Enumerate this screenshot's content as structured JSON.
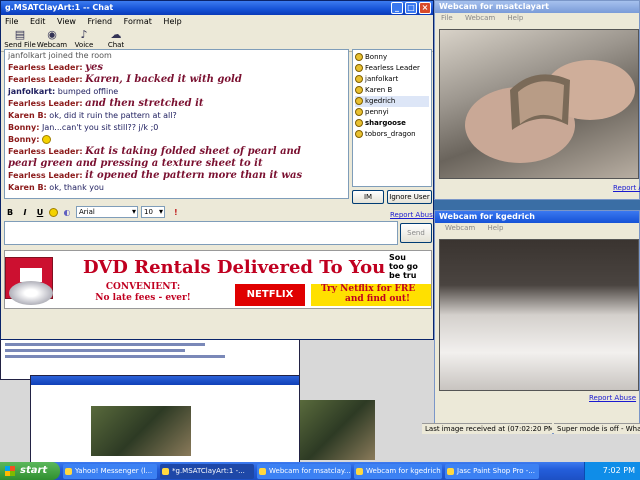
{
  "chat_window": {
    "title": "g.MSATClayArt:1 -- Chat",
    "menu": [
      "File",
      "Edit",
      "View",
      "Friend",
      "Format",
      "Help"
    ],
    "toolbar": [
      {
        "label": "Send File",
        "icon": "send-file-icon"
      },
      {
        "label": "Webcam",
        "icon": "webcam-icon"
      },
      {
        "label": "Voice",
        "icon": "voice-icon"
      },
      {
        "label": "Chat",
        "icon": "chat-icon"
      }
    ],
    "transcript": [
      {
        "who": "",
        "text": "janfolkart joined the room",
        "style": "sys"
      },
      {
        "who": "Fearless Leader:",
        "text": "yes",
        "style": "ital"
      },
      {
        "who": "Fearless Leader:",
        "text": "Karen, I backed it with gold",
        "style": "ital"
      },
      {
        "who": "janfolkart:",
        "text": "bumped offline",
        "style": "plain"
      },
      {
        "who": "Fearless Leader:",
        "text": "and then stretched it",
        "style": "ital"
      },
      {
        "who": "Karen B:",
        "text": "ok, did it ruin the pattern at all?",
        "style": "plain"
      },
      {
        "who": "Bonny:",
        "text": "Jan...can't you sit still?? j/k ;0",
        "style": "plain"
      },
      {
        "who": "Bonny:",
        "text": "",
        "style": "smiley"
      },
      {
        "who": "Fearless Leader:",
        "text": "Kat is taking folded sheet of pearl and",
        "style": "ital"
      },
      {
        "who": "",
        "text": "pearl green and pressing a texture sheet to it",
        "style": "ital"
      },
      {
        "who": "Fearless Leader:",
        "text": "it opened the pattern more than it was",
        "style": "ital"
      },
      {
        "who": "Karen B:",
        "text": "ok, thank you",
        "style": "plain"
      }
    ],
    "users": [
      "Bonny",
      "Fearless Leader",
      "janfolkart",
      "Karen B",
      "kgedrich",
      "pennyi",
      "shargoose",
      "tobors_dragon"
    ],
    "selected_user": "kgedrich",
    "im_label": "IM",
    "ignore_label": "Ignore User",
    "format": {
      "bold": "B",
      "italic": "I",
      "underline": "U",
      "font": "Arial",
      "size": "10"
    },
    "report_abuse": "Report Abuse",
    "send_label": "Send",
    "input_value": ""
  },
  "ad": {
    "headline": "DVD Rentals Delivered To You",
    "convenient": "CONVENIENT:",
    "no_late": "No late fees - ever!",
    "brand": "NETFLIX",
    "try": "Try Netflix for FRE",
    "find_out": "and find out!",
    "side": "Sou\ntoo go\nbe tru"
  },
  "cam1": {
    "title": "Webcam for msatclayart",
    "menu": [
      "File",
      "Webcam",
      "Help"
    ],
    "report": "Report A"
  },
  "cam2": {
    "title": "Webcam for kgedrich",
    "menu": [
      "Webcam",
      "Help"
    ],
    "report": "Report Abuse"
  },
  "status": {
    "last_image": "Last image received at (07:02:20 PM)",
    "super_mode": "Super mode is off - What's thi"
  },
  "taskbar": {
    "start": "start",
    "tasks": [
      "Yahoo! Messenger (l...",
      "*g.MSATClayArt:1 -...",
      "Webcam for msatclay...",
      "Webcam for kgedrich",
      "Jasc Paint Shop Pro -..."
    ],
    "clock": "7:02 PM"
  }
}
